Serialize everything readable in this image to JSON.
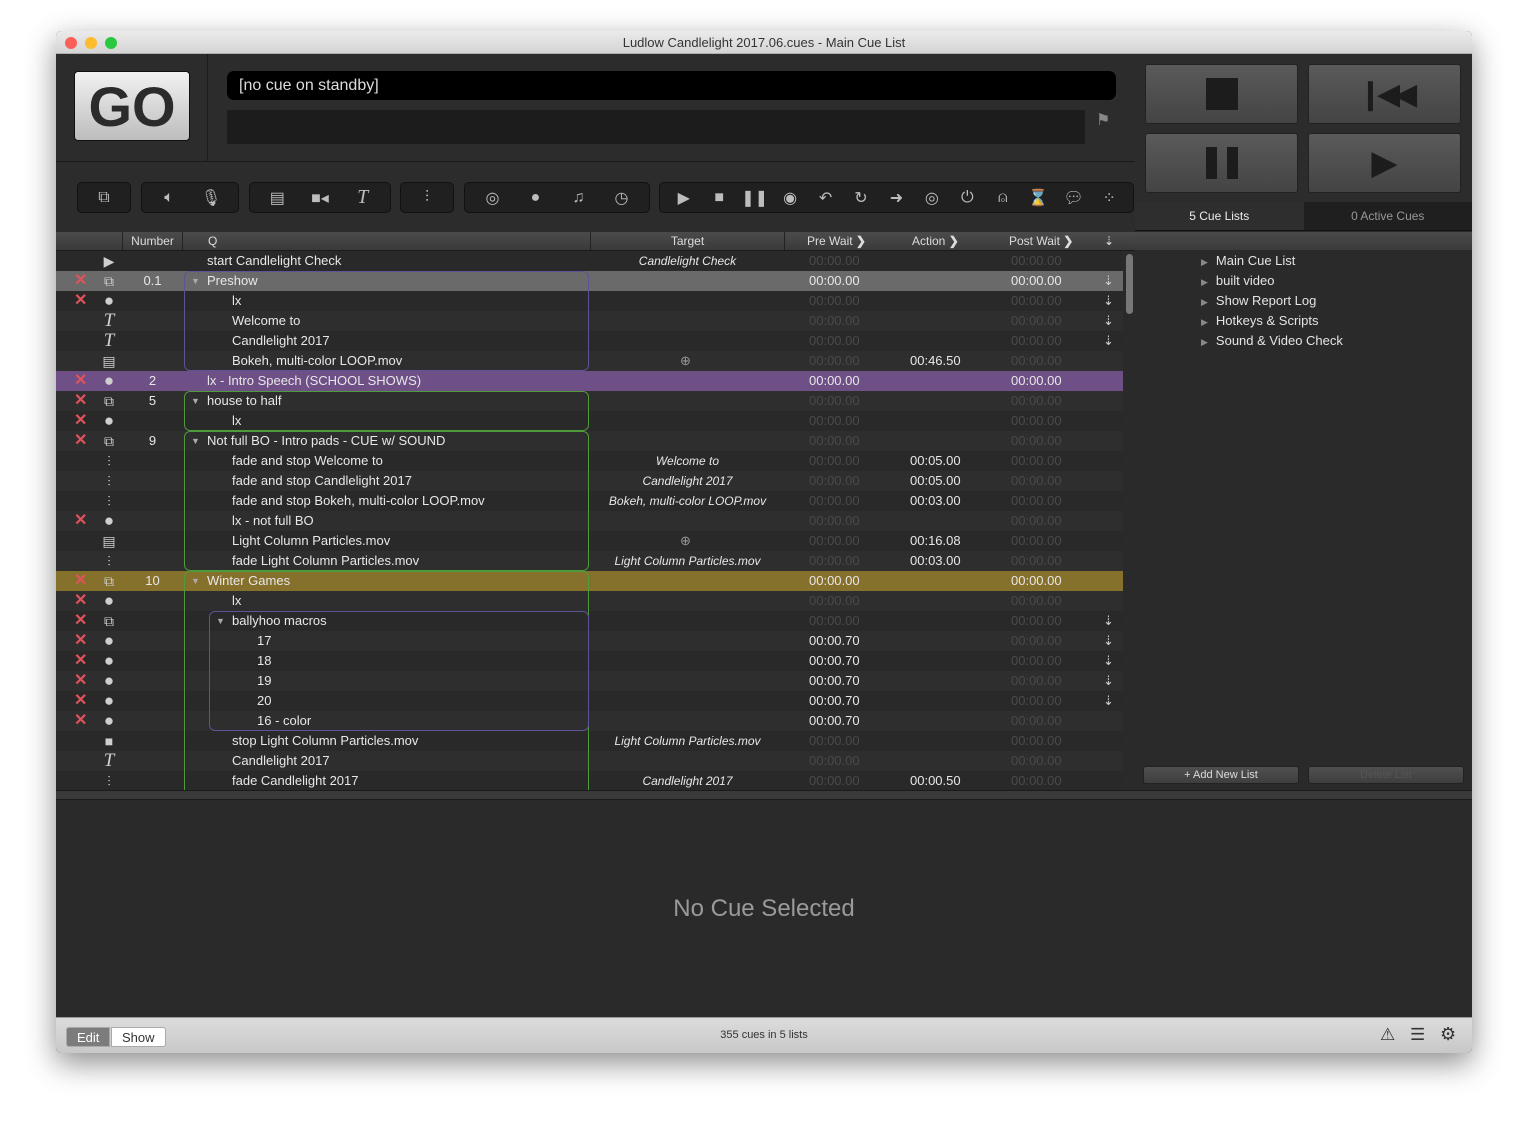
{
  "window": {
    "title": "Ludlow Candlelight 2017.06.cues - Main Cue List"
  },
  "go_button": {
    "label": "GO"
  },
  "standby": {
    "text": "[no cue on standby]"
  },
  "transport": {
    "buttons": [
      "stop",
      "previous",
      "pause",
      "play"
    ]
  },
  "toolbar": {
    "groups": [
      [
        {
          "icon": "group-cue-icon",
          "glyph": "⧉"
        }
      ],
      [
        {
          "icon": "audio-cue-icon",
          "glyph": "🔈︎"
        },
        {
          "icon": "mic-cue-icon",
          "glyph": "🎙︎"
        }
      ],
      [
        {
          "icon": "video-cue-icon",
          "glyph": "▤"
        },
        {
          "icon": "camera-cue-icon",
          "glyph": "■◂"
        },
        {
          "icon": "text-cue-icon",
          "glyph": "T"
        }
      ],
      [
        {
          "icon": "fade-cue-icon",
          "glyph": "⫶"
        }
      ],
      [
        {
          "icon": "network-cue-icon",
          "glyph": "◎"
        },
        {
          "icon": "midi-cue-icon",
          "glyph": "●"
        },
        {
          "icon": "music-cue-icon",
          "glyph": "♫"
        },
        {
          "icon": "timecode-cue-icon",
          "glyph": "◷"
        }
      ],
      [
        {
          "icon": "start-cue-icon",
          "glyph": "▶"
        },
        {
          "icon": "stop-cue-icon",
          "glyph": "■"
        },
        {
          "icon": "pause-cue-icon",
          "glyph": "❚❚"
        },
        {
          "icon": "load-cue-icon",
          "glyph": "◉"
        },
        {
          "icon": "reset-cue-icon",
          "glyph": "↶"
        },
        {
          "icon": "devamp-cue-icon",
          "glyph": "↻"
        },
        {
          "icon": "goto-cue-icon",
          "glyph": "➜"
        },
        {
          "icon": "target-cue-icon",
          "glyph": "◎"
        },
        {
          "icon": "arm-cue-icon",
          "glyph": "⏻"
        },
        {
          "icon": "disarm-cue-icon",
          "glyph": "⍝"
        },
        {
          "icon": "wait-cue-icon",
          "glyph": "⌛"
        },
        {
          "icon": "memo-cue-icon",
          "glyph": "💬︎"
        },
        {
          "icon": "script-cue-icon",
          "glyph": "⁘"
        }
      ]
    ]
  },
  "table": {
    "headers": {
      "number": "Number",
      "q": "Q",
      "target": "Target",
      "pre_wait": "Pre Wait",
      "action": "Action",
      "post_wait": "Post Wait"
    },
    "rows": [
      {
        "icon": "start",
        "broken": false,
        "number": "",
        "name": "start Candlelight Check",
        "level": 0,
        "tri": false,
        "target": "Candlelight Check",
        "pre": "00:00.00",
        "pre_on": false,
        "action": "",
        "post": "00:00.00",
        "post_on": false,
        "cont": false,
        "bg": ""
      },
      {
        "icon": "group",
        "broken": true,
        "number": "0.1",
        "name": "Preshow",
        "level": 0,
        "tri": true,
        "target": "",
        "pre": "00:00.00",
        "pre_on": true,
        "action": "",
        "post": "00:00.00",
        "post_on": true,
        "cont": true,
        "bg": "selected"
      },
      {
        "icon": "midi",
        "broken": true,
        "number": "",
        "name": "lx",
        "level": 1,
        "tri": false,
        "target": "",
        "pre": "00:00.00",
        "pre_on": false,
        "action": "",
        "post": "00:00.00",
        "post_on": false,
        "cont": true,
        "bg": ""
      },
      {
        "icon": "text",
        "broken": false,
        "number": "",
        "name": "Welcome to",
        "level": 1,
        "tri": false,
        "target": "",
        "pre": "00:00.00",
        "pre_on": false,
        "action": "",
        "post": "00:00.00",
        "post_on": false,
        "cont": true,
        "bg": ""
      },
      {
        "icon": "text",
        "broken": false,
        "number": "",
        "name": "Candlelight 2017",
        "level": 1,
        "tri": false,
        "target": "",
        "pre": "00:00.00",
        "pre_on": false,
        "action": "",
        "post": "00:00.00",
        "post_on": false,
        "cont": true,
        "bg": ""
      },
      {
        "icon": "video",
        "broken": false,
        "number": "",
        "name": "Bokeh, multi-color LOOP.mov",
        "level": 1,
        "tri": false,
        "target": "+",
        "pre": "00:00.00",
        "pre_on": false,
        "action": "00:46.50",
        "post": "00:00.00",
        "post_on": false,
        "cont": false,
        "bg": ""
      },
      {
        "icon": "midi",
        "broken": true,
        "number": "2",
        "name": "lx - Intro Speech (SCHOOL SHOWS)",
        "level": 0,
        "tri": false,
        "target": "",
        "pre": "00:00.00",
        "pre_on": true,
        "action": "",
        "post": "00:00.00",
        "post_on": true,
        "cont": false,
        "bg": "purple"
      },
      {
        "icon": "group",
        "broken": true,
        "number": "5",
        "name": "house to half",
        "level": 0,
        "tri": true,
        "target": "",
        "pre": "00:00.00",
        "pre_on": false,
        "action": "",
        "post": "00:00.00",
        "post_on": false,
        "cont": false,
        "bg": ""
      },
      {
        "icon": "midi",
        "broken": true,
        "number": "",
        "name": "lx",
        "level": 1,
        "tri": false,
        "target": "",
        "pre": "00:00.00",
        "pre_on": false,
        "action": "",
        "post": "00:00.00",
        "post_on": false,
        "cont": false,
        "bg": ""
      },
      {
        "icon": "group",
        "broken": true,
        "number": "9",
        "name": "Not full BO - Intro pads - CUE w/ SOUND",
        "level": 0,
        "tri": true,
        "target": "",
        "pre": "00:00.00",
        "pre_on": false,
        "action": "",
        "post": "00:00.00",
        "post_on": false,
        "cont": false,
        "bg": ""
      },
      {
        "icon": "fade",
        "broken": false,
        "number": "",
        "name": "fade and stop Welcome to",
        "level": 1,
        "tri": false,
        "target": "Welcome to",
        "pre": "00:00.00",
        "pre_on": false,
        "action": "00:05.00",
        "post": "00:00.00",
        "post_on": false,
        "cont": false,
        "bg": ""
      },
      {
        "icon": "fade",
        "broken": false,
        "number": "",
        "name": "fade and stop Candlelight 2017",
        "level": 1,
        "tri": false,
        "target": "Candlelight 2017",
        "pre": "00:00.00",
        "pre_on": false,
        "action": "00:05.00",
        "post": "00:00.00",
        "post_on": false,
        "cont": false,
        "bg": ""
      },
      {
        "icon": "fade",
        "broken": false,
        "number": "",
        "name": "fade and stop Bokeh, multi-color LOOP.mov",
        "level": 1,
        "tri": false,
        "target": "Bokeh, multi-color LOOP.mov",
        "pre": "00:00.00",
        "pre_on": false,
        "action": "00:03.00",
        "post": "00:00.00",
        "post_on": false,
        "cont": false,
        "bg": ""
      },
      {
        "icon": "midi",
        "broken": true,
        "number": "",
        "name": "lx - not full BO",
        "level": 1,
        "tri": false,
        "target": "",
        "pre": "00:00.00",
        "pre_on": false,
        "action": "",
        "post": "00:00.00",
        "post_on": false,
        "cont": false,
        "bg": ""
      },
      {
        "icon": "video",
        "broken": false,
        "number": "",
        "name": "Light Column Particles.mov",
        "level": 1,
        "tri": false,
        "target": "+",
        "pre": "00:00.00",
        "pre_on": false,
        "action": "00:16.08",
        "post": "00:00.00",
        "post_on": false,
        "cont": false,
        "bg": ""
      },
      {
        "icon": "fade",
        "broken": false,
        "number": "",
        "name": "fade Light Column Particles.mov",
        "level": 1,
        "tri": false,
        "target": "Light Column Particles.mov",
        "pre": "00:00.00",
        "pre_on": false,
        "action": "00:03.00",
        "post": "00:00.00",
        "post_on": false,
        "cont": false,
        "bg": ""
      },
      {
        "icon": "group",
        "broken": true,
        "number": "10",
        "name": "Winter Games",
        "level": 0,
        "tri": true,
        "target": "",
        "pre": "00:00.00",
        "pre_on": true,
        "action": "",
        "post": "00:00.00",
        "post_on": true,
        "cont": false,
        "bg": "gold"
      },
      {
        "icon": "midi",
        "broken": true,
        "number": "",
        "name": "lx",
        "level": 1,
        "tri": false,
        "target": "",
        "pre": "00:00.00",
        "pre_on": false,
        "action": "",
        "post": "00:00.00",
        "post_on": false,
        "cont": false,
        "bg": ""
      },
      {
        "icon": "group",
        "broken": true,
        "number": "",
        "name": "ballyhoo macros",
        "level": 1,
        "tri": true,
        "target": "",
        "pre": "00:00.00",
        "pre_on": false,
        "action": "",
        "post": "00:00.00",
        "post_on": false,
        "cont": true,
        "bg": ""
      },
      {
        "icon": "midi",
        "broken": true,
        "number": "",
        "name": "17",
        "level": 2,
        "tri": false,
        "target": "",
        "pre": "00:00.70",
        "pre_on": true,
        "action": "",
        "post": "00:00.00",
        "post_on": false,
        "cont": true,
        "bg": ""
      },
      {
        "icon": "midi",
        "broken": true,
        "number": "",
        "name": "18",
        "level": 2,
        "tri": false,
        "target": "",
        "pre": "00:00.70",
        "pre_on": true,
        "action": "",
        "post": "00:00.00",
        "post_on": false,
        "cont": true,
        "bg": ""
      },
      {
        "icon": "midi",
        "broken": true,
        "number": "",
        "name": "19",
        "level": 2,
        "tri": false,
        "target": "",
        "pre": "00:00.70",
        "pre_on": true,
        "action": "",
        "post": "00:00.00",
        "post_on": false,
        "cont": true,
        "bg": ""
      },
      {
        "icon": "midi",
        "broken": true,
        "number": "",
        "name": "20",
        "level": 2,
        "tri": false,
        "target": "",
        "pre": "00:00.70",
        "pre_on": true,
        "action": "",
        "post": "00:00.00",
        "post_on": false,
        "cont": true,
        "bg": ""
      },
      {
        "icon": "midi",
        "broken": true,
        "number": "",
        "name": "16 - color",
        "level": 2,
        "tri": false,
        "target": "",
        "pre": "00:00.70",
        "pre_on": true,
        "action": "",
        "post": "00:00.00",
        "post_on": false,
        "cont": false,
        "bg": ""
      },
      {
        "icon": "stop",
        "broken": false,
        "number": "",
        "name": "stop Light Column Particles.mov",
        "level": 1,
        "tri": false,
        "target": "Light Column Particles.mov",
        "pre": "00:00.00",
        "pre_on": false,
        "action": "",
        "post": "00:00.00",
        "post_on": false,
        "cont": false,
        "bg": ""
      },
      {
        "icon": "text",
        "broken": false,
        "number": "",
        "name": "Candlelight 2017",
        "level": 1,
        "tri": false,
        "target": "",
        "pre": "00:00.00",
        "pre_on": false,
        "action": "",
        "post": "00:00.00",
        "post_on": false,
        "cont": false,
        "bg": ""
      },
      {
        "icon": "fade",
        "broken": false,
        "number": "",
        "name": "fade Candlelight 2017",
        "level": 1,
        "tri": false,
        "target": "Candlelight 2017",
        "pre": "00:00.00",
        "pre_on": false,
        "action": "00:00.50",
        "post": "00:00.00",
        "post_on": false,
        "cont": false,
        "bg": ""
      }
    ]
  },
  "colors": {
    "selected": "#6a6a6a",
    "purple": "#6e4f86",
    "gold": "#85702c",
    "group_purple": "#5c5496",
    "group_green": "#4f9a3a",
    "broken": "#e2525a"
  },
  "right_panel": {
    "tabs": [
      "5 Cue Lists",
      "0 Active Cues"
    ],
    "lists": [
      "Main Cue List",
      "built video",
      "Show Report Log",
      "Hotkeys & Scripts",
      "Sound & Video Check"
    ],
    "add_button": "+ Add New List",
    "delete_button": "Delete List"
  },
  "inspector": {
    "empty_text": "No Cue Selected"
  },
  "status_bar": {
    "modes": [
      "Edit",
      "Show"
    ],
    "count_text": "355 cues in 5 lists"
  }
}
